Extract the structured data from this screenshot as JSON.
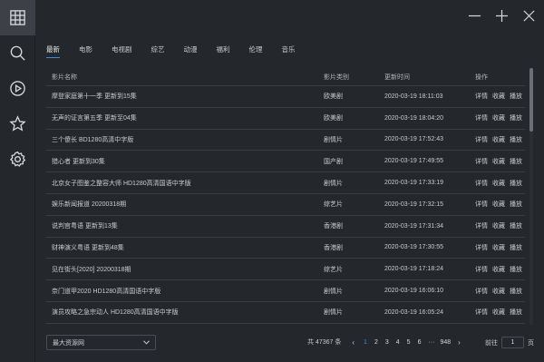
{
  "window": {
    "controls": [
      "minimize-icon",
      "maximize-icon",
      "close-icon"
    ]
  },
  "sidebar": {
    "items": [
      {
        "icon": "grid-icon",
        "active": true
      },
      {
        "icon": "search-icon",
        "active": false
      },
      {
        "icon": "play-icon",
        "active": false
      },
      {
        "icon": "star-icon",
        "active": false
      },
      {
        "icon": "gear-icon",
        "active": false
      }
    ]
  },
  "tabs": [
    "最新",
    "电影",
    "电视剧",
    "综艺",
    "动漫",
    "福利",
    "伦理",
    "音乐"
  ],
  "table": {
    "headers": [
      "影片名称",
      "影片类别",
      "更新时间",
      "操作"
    ],
    "actions": [
      "详情",
      "收藏",
      "播放"
    ],
    "rows": [
      [
        "摩登家庭第十一季 更新到15集",
        "欧美剧",
        "2020-03-19 18:11:03"
      ],
      [
        "无声的证言第五季 更新至04集",
        "欧美剧",
        "2020-03-19 18:04:20"
      ],
      [
        "三个傻长 BD1280高清中字版",
        "剧情片",
        "2020-03-19 17:52:43"
      ],
      [
        "猎心者 更新到30集",
        "国产剧",
        "2020-03-19 17:49:55"
      ],
      [
        "北京女子图鉴之整容大师 HD1280高清国语中字版",
        "剧情片",
        "2020-03-19 17:33:19"
      ],
      [
        "娱乐新闻报道 20200318期",
        "综艺片",
        "2020-03-19 17:32:15"
      ],
      [
        "说判官粤语 更新到13集",
        "香港剧",
        "2020-03-19 17:31:34"
      ],
      [
        "财神演义粤语 更新到48集",
        "香港剧",
        "2020-03-19 17:30:55"
      ],
      [
        "见在街头[2020] 20200318期",
        "综艺片",
        "2020-03-19 17:18:24"
      ],
      [
        "奈门道甲2020 HD1280高清国语中字版",
        "剧情片",
        "2020-03-19 16:06:10"
      ],
      [
        "演员攻略之急宗动人 HD1280高清国语中字版",
        "剧情片",
        "2020-03-19 16:05:24"
      ]
    ]
  },
  "source_select": {
    "value": "最大资源网"
  },
  "pagination": {
    "total": "共 47367 条",
    "prev": "‹",
    "pages": [
      "1",
      "2",
      "3",
      "4",
      "5",
      "6"
    ],
    "current": "1",
    "dots": "···",
    "last": "948",
    "next": "›",
    "goto_label": "前往",
    "goto_value": "1",
    "page_suffix": "页"
  },
  "colors": {
    "accent": "#3c8ae6",
    "background": "#24272b"
  }
}
